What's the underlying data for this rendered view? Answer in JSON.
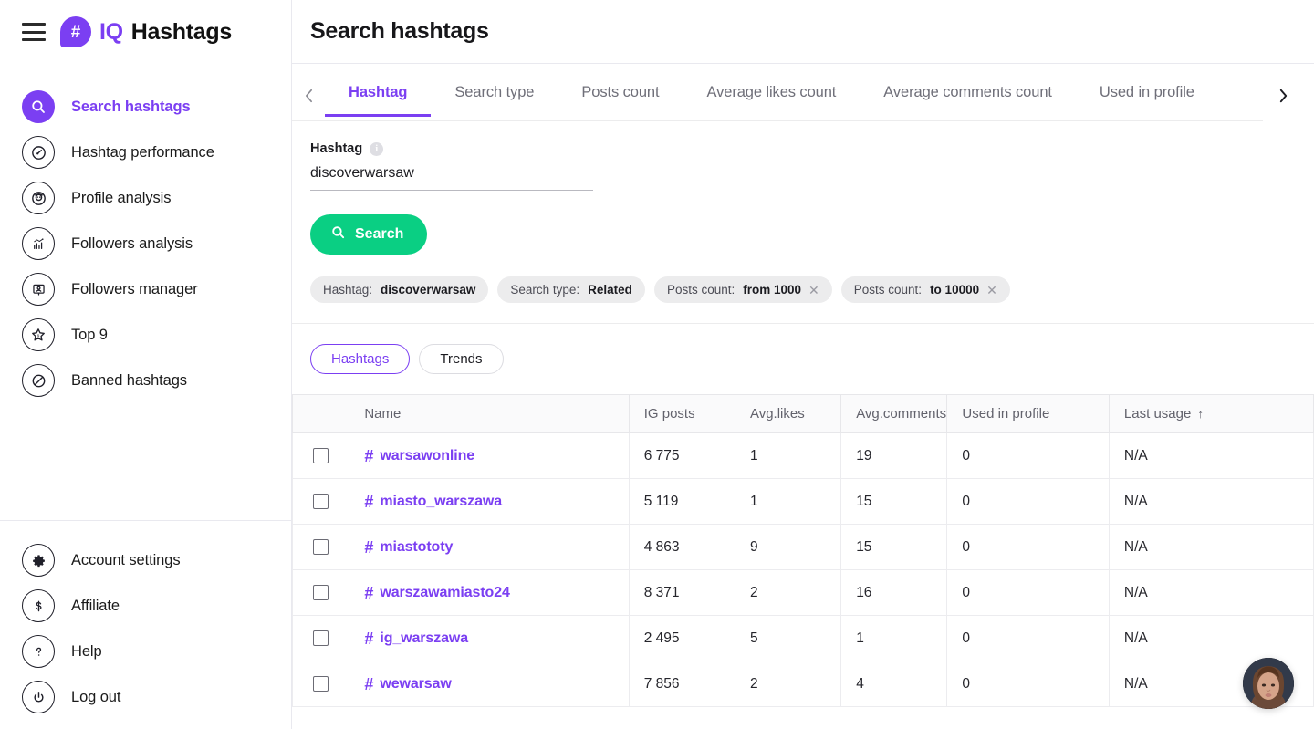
{
  "brand": {
    "iq": "IQ",
    "name": "Hashtags",
    "logo_glyph": "#"
  },
  "header": {
    "title": "Search hashtags"
  },
  "sidebar": {
    "top_items": [
      {
        "label": "Search hashtags",
        "icon": "search-icon",
        "active": true
      },
      {
        "label": "Hashtag performance",
        "icon": "gauge-icon",
        "active": false
      },
      {
        "label": "Profile analysis",
        "icon": "person-circle-icon",
        "active": false
      },
      {
        "label": "Followers analysis",
        "icon": "bar-chart-icon",
        "active": false
      },
      {
        "label": "Followers manager",
        "icon": "id-card-icon",
        "active": false
      },
      {
        "label": "Top 9",
        "icon": "star-icon",
        "active": false
      },
      {
        "label": "Banned hashtags",
        "icon": "blocked-icon",
        "active": false
      }
    ],
    "bottom_items": [
      {
        "label": "Account settings",
        "icon": "gear-icon"
      },
      {
        "label": "Affiliate",
        "icon": "dollar-icon"
      },
      {
        "label": "Help",
        "icon": "question-icon"
      },
      {
        "label": "Log out",
        "icon": "power-icon"
      }
    ]
  },
  "tabs": {
    "prev_label": "‹",
    "next_label": "›",
    "items": [
      {
        "label": "Hashtag",
        "active": true
      },
      {
        "label": "Search type",
        "active": false
      },
      {
        "label": "Posts count",
        "active": false
      },
      {
        "label": "Average likes count",
        "active": false
      },
      {
        "label": "Average comments count",
        "active": false
      },
      {
        "label": "Used in profile",
        "active": false
      }
    ]
  },
  "form": {
    "field_label": "Hashtag",
    "info_glyph": "i",
    "hashtag_value": "discoverwarsaw",
    "hashtag_placeholder": "Hashtag",
    "search_button": "Search"
  },
  "chips": [
    {
      "prefix": "Hashtag:",
      "value": "discoverwarsaw",
      "removable": false
    },
    {
      "prefix": "Search type:",
      "value": "Related",
      "removable": false
    },
    {
      "prefix": "Posts count:",
      "value": "from 1000",
      "removable": true
    },
    {
      "prefix": "Posts count:",
      "value": "to 10000",
      "removable": true
    }
  ],
  "view_toggle": [
    {
      "label": "Hashtags",
      "active": true
    },
    {
      "label": "Trends",
      "active": false
    }
  ],
  "table": {
    "columns": [
      "",
      "Name",
      "IG posts",
      "Avg.likes",
      "Avg.comments",
      "Used in profile",
      "Last usage"
    ],
    "sort_column": "Last usage",
    "sort_arrow": "↑",
    "rows": [
      {
        "name": "warsawonline",
        "ig_posts": "6 775",
        "avg_likes": "1",
        "avg_comments": "19",
        "used_in_profile": "0",
        "last_usage": "N/A"
      },
      {
        "name": "miasto_warszawa",
        "ig_posts": "5 119",
        "avg_likes": "1",
        "avg_comments": "15",
        "used_in_profile": "0",
        "last_usage": "N/A"
      },
      {
        "name": "miastototy",
        "ig_posts": "4 863",
        "avg_likes": "9",
        "avg_comments": "15",
        "used_in_profile": "0",
        "last_usage": "N/A"
      },
      {
        "name": "warszawamiasto24",
        "ig_posts": "8 371",
        "avg_likes": "2",
        "avg_comments": "16",
        "used_in_profile": "0",
        "last_usage": "N/A"
      },
      {
        "name": "ig_warszawa",
        "ig_posts": "2 495",
        "avg_likes": "5",
        "avg_comments": "1",
        "used_in_profile": "0",
        "last_usage": "N/A"
      },
      {
        "name": "wewarsaw",
        "ig_posts": "7 856",
        "avg_likes": "2",
        "avg_comments": "4",
        "used_in_profile": "0",
        "last_usage": "N/A"
      }
    ],
    "hash_glyph": "#"
  },
  "colors": {
    "brand_purple": "#7B3FF2",
    "success_green": "#0ACF83",
    "text_dark": "#1b1b20",
    "muted": "#62626c",
    "chip_bg": "#ececed"
  }
}
